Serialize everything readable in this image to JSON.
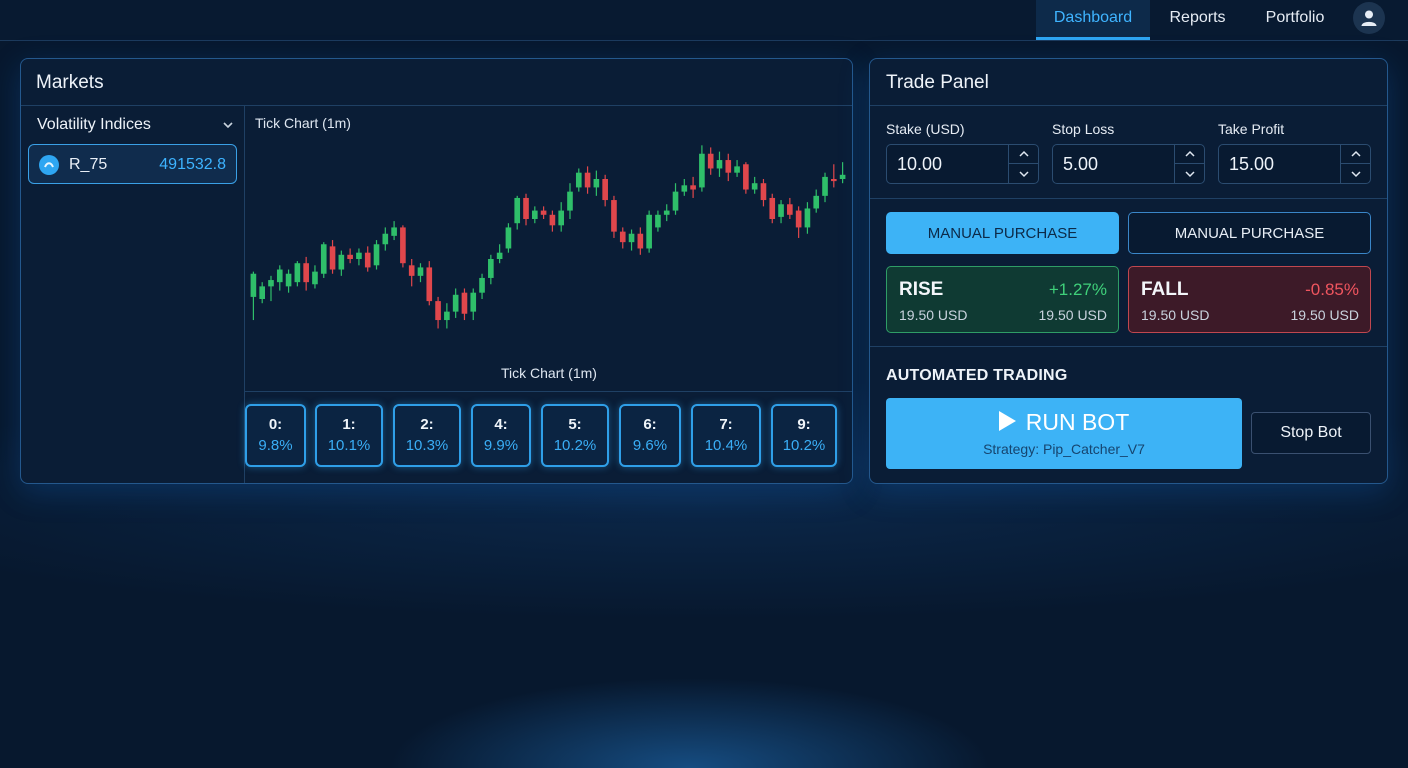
{
  "nav": {
    "items": [
      "Dashboard",
      "Reports",
      "Portfolio"
    ],
    "active": "Dashboard",
    "avatar_icon": "user-icon"
  },
  "markets": {
    "title": "Markets",
    "category": "Volatility Indices",
    "selected": {
      "symbol": "R_75",
      "price": "491532.8",
      "icon": "market-dot-icon"
    },
    "chart_title": "Tick Chart (1m)",
    "chart_caption": "Tick Chart (1m)",
    "digits": [
      {
        "digit": "0:",
        "pct": "9.8%"
      },
      {
        "digit": "1:",
        "pct": "10.1%"
      },
      {
        "digit": "2:",
        "pct": "10.3%"
      },
      {
        "digit": "4:",
        "pct": "9.9%"
      },
      {
        "digit": "5:",
        "pct": "10.2%"
      },
      {
        "digit": "6:",
        "pct": "9.6%"
      },
      {
        "digit": "7:",
        "pct": "10.4%"
      },
      {
        "digit": "9:",
        "pct": "10.2%"
      }
    ]
  },
  "chart_data": {
    "type": "candlestick",
    "title": "Tick Chart (1m)",
    "colors": {
      "up": "#2fbf6a",
      "down": "#e0474c"
    },
    "candles": [
      [
        45,
        56,
        34,
        57
      ],
      [
        44,
        50,
        42,
        52
      ],
      [
        50,
        53,
        43,
        55
      ],
      [
        52,
        58,
        48,
        60
      ],
      [
        50,
        56,
        47,
        58
      ],
      [
        52,
        61,
        50,
        62
      ],
      [
        61,
        52,
        48,
        64
      ],
      [
        51,
        57,
        49,
        60
      ],
      [
        56,
        70,
        54,
        71
      ],
      [
        69,
        58,
        56,
        72
      ],
      [
        58,
        65,
        55,
        67
      ],
      [
        65,
        63,
        61,
        68
      ],
      [
        63,
        66,
        60,
        68
      ],
      [
        66,
        59,
        57,
        69
      ],
      [
        60,
        70,
        58,
        72
      ],
      [
        70,
        75,
        67,
        78
      ],
      [
        74,
        78,
        72,
        81
      ],
      [
        78,
        61,
        59,
        79
      ],
      [
        60,
        55,
        50,
        63
      ],
      [
        55,
        59,
        52,
        61
      ],
      [
        59,
        43,
        41,
        62
      ],
      [
        43,
        34,
        30,
        45
      ],
      [
        34,
        38,
        30,
        42
      ],
      [
        38,
        46,
        35,
        49
      ],
      [
        47,
        37,
        34,
        49
      ],
      [
        38,
        47,
        34,
        49
      ],
      [
        47,
        54,
        44,
        56
      ],
      [
        54,
        63,
        51,
        65
      ],
      [
        63,
        66,
        61,
        70
      ],
      [
        68,
        78,
        66,
        80
      ],
      [
        80,
        92,
        77,
        93
      ],
      [
        92,
        82,
        79,
        94
      ],
      [
        82,
        86,
        80,
        88
      ],
      [
        86,
        84,
        82,
        88
      ],
      [
        84,
        79,
        76,
        86
      ],
      [
        79,
        86,
        76,
        90
      ],
      [
        86,
        95,
        82,
        99
      ],
      [
        97,
        104,
        95,
        106
      ],
      [
        104,
        97,
        94,
        107
      ],
      [
        97,
        101,
        93,
        105
      ],
      [
        101,
        91,
        88,
        103
      ],
      [
        91,
        76,
        73,
        93
      ],
      [
        76,
        71,
        68,
        78
      ],
      [
        71,
        75,
        67,
        77
      ],
      [
        75,
        68,
        65,
        78
      ],
      [
        68,
        84,
        66,
        86
      ],
      [
        78,
        84,
        76,
        86
      ],
      [
        84,
        86,
        81,
        89
      ],
      [
        86,
        95,
        84,
        99
      ],
      [
        95,
        98,
        93,
        101
      ],
      [
        98,
        96,
        92,
        102
      ],
      [
        97,
        113,
        95,
        117
      ],
      [
        113,
        106,
        103,
        116
      ],
      [
        106,
        110,
        102,
        114
      ],
      [
        110,
        104,
        100,
        113
      ],
      [
        104,
        107,
        102,
        110
      ],
      [
        108,
        96,
        94,
        109
      ],
      [
        96,
        99,
        94,
        102
      ],
      [
        99,
        91,
        88,
        101
      ],
      [
        92,
        82,
        80,
        94
      ],
      [
        83,
        89,
        80,
        91
      ],
      [
        89,
        84,
        82,
        92
      ],
      [
        86,
        78,
        73,
        88
      ],
      [
        78,
        87,
        75,
        90
      ],
      [
        87,
        93,
        85,
        96
      ],
      [
        93,
        102,
        90,
        104
      ],
      [
        101,
        100,
        97,
        108
      ],
      [
        101,
        103,
        99,
        109
      ]
    ],
    "ylim": [
      25,
      120
    ]
  },
  "trade": {
    "title": "Trade Panel",
    "fields": [
      {
        "label": "Stake (USD)",
        "value": "10.00"
      },
      {
        "label": "Stop Loss",
        "value": "5.00"
      },
      {
        "label": "Take Profit",
        "value": "15.00"
      }
    ],
    "manual_primary": "MANUAL PURCHASE",
    "manual_secondary": "MANUAL PURCHASE",
    "rise": {
      "name": "RISE",
      "change": "+1.27%",
      "left": "19.50 USD",
      "right": "19.50 USD",
      "color": "#3fd07a"
    },
    "fall": {
      "name": "FALL",
      "change": "-0.85%",
      "left": "19.50 USD",
      "right": "19.50 USD",
      "color": "#f0555f"
    },
    "auto_title": "AUTOMATED TRADING",
    "run_bot": "RUN BOT",
    "strategy": "Strategy: Pip_Catcher_V7",
    "stop_bot": "Stop Bot"
  }
}
